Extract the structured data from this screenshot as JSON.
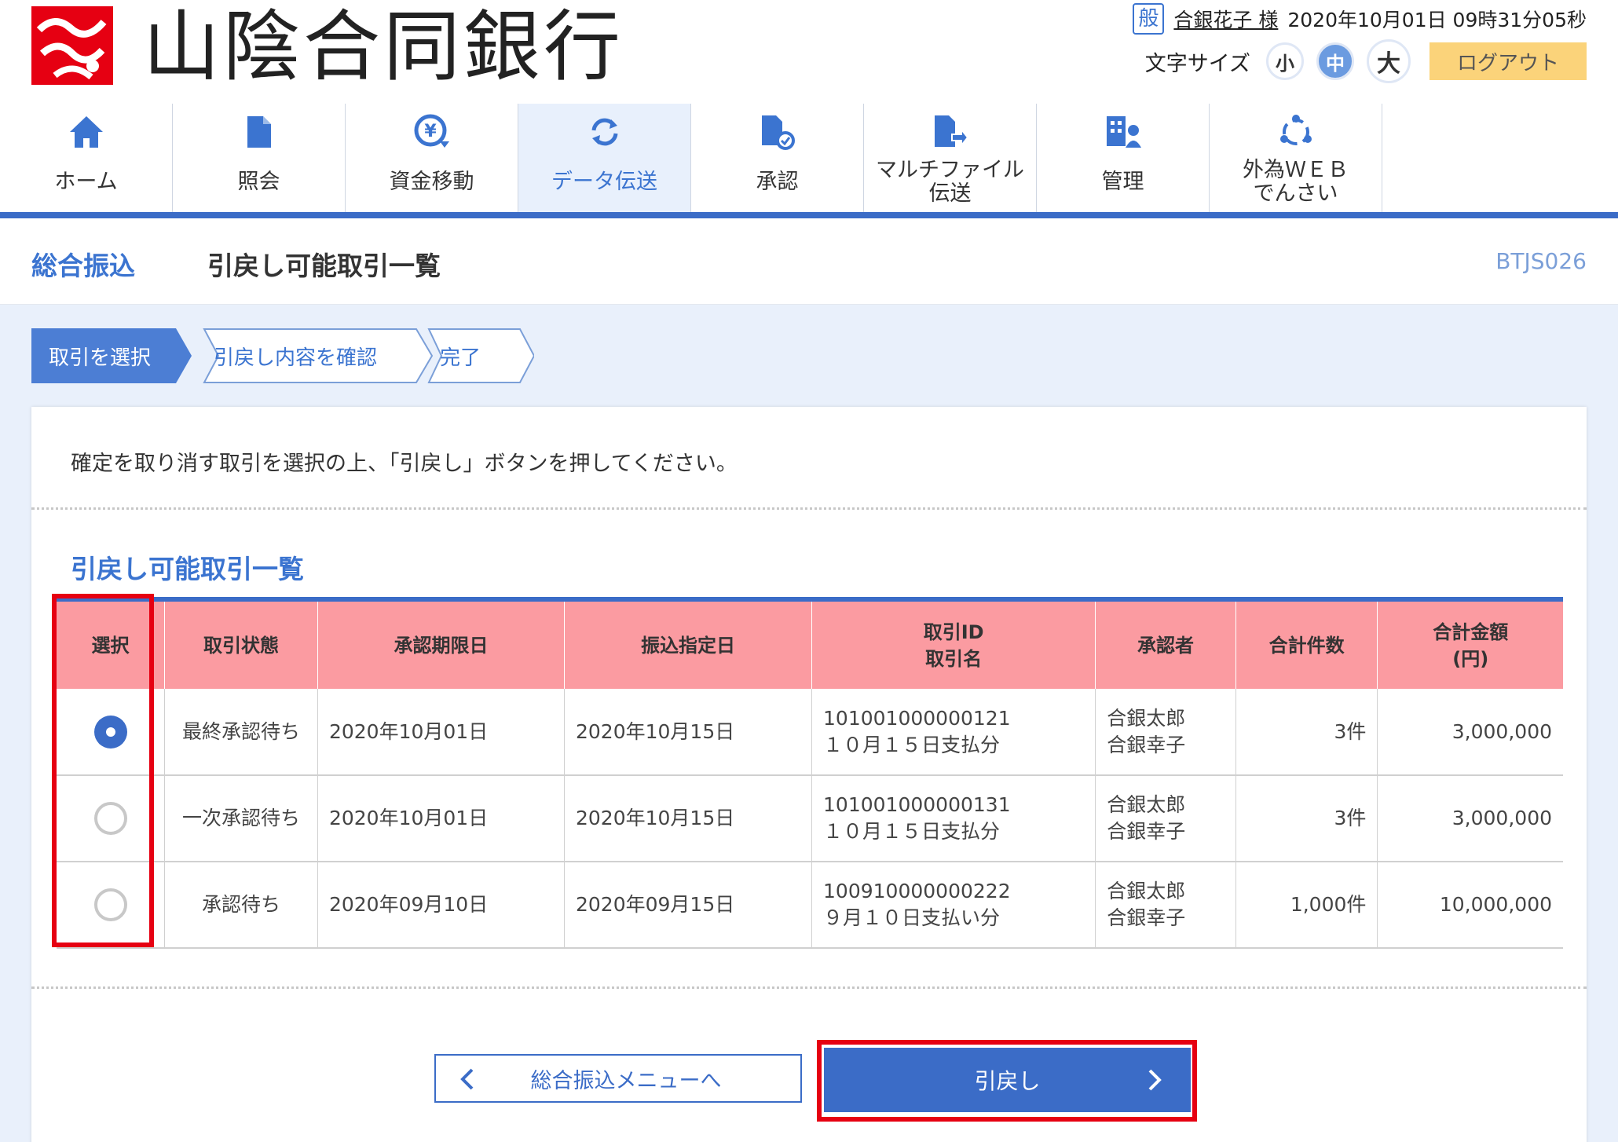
{
  "bank": {
    "name": "山陰合同銀行"
  },
  "user": {
    "badge": "般",
    "name": "合銀花子 様",
    "datetime": "2020年10月01日 09時31分05秒"
  },
  "font_size": {
    "label": "文字サイズ",
    "small": "小",
    "medium": "中",
    "large": "大",
    "selected": "中"
  },
  "logout_label": "ログアウト",
  "nav": {
    "items": [
      {
        "label": "ホーム",
        "icon": "home-icon"
      },
      {
        "label": "照会",
        "icon": "document-icon"
      },
      {
        "label": "資金移動",
        "icon": "yen-transfer-icon"
      },
      {
        "label": "データ伝送",
        "icon": "refresh-icon",
        "active": true
      },
      {
        "label": "承認",
        "icon": "approve-document-icon"
      },
      {
        "label": "マルチファイル\n伝送",
        "icon": "file-transfer-icon"
      },
      {
        "label": "管理",
        "icon": "management-icon"
      },
      {
        "label": "外為ＷＥＢ\nでんさい",
        "icon": "cycle-icon"
      }
    ]
  },
  "page": {
    "category": "総合振込",
    "title": "引戻し可能取引一覧",
    "screen_id": "BTJS026"
  },
  "steps": [
    "取引を選択",
    "引戻し内容を確認",
    "完了"
  ],
  "instruction": "確定を取り消す取引を選択の上、「引戻し」ボタンを押してください。",
  "section_title": "引戻し可能取引一覧",
  "table": {
    "headers": {
      "select": "選択",
      "status": "取引状態",
      "deadline": "承認期限日",
      "transfer_date": "振込指定日",
      "id_line1": "取引ID",
      "id_line2": "取引名",
      "approver": "承認者",
      "count": "合計件数",
      "amount_line1": "合計金額",
      "amount_line2": "(円)"
    },
    "rows": [
      {
        "selected": true,
        "status": "最終承認待ち",
        "deadline": "2020年10月01日",
        "transfer_date": "2020年10月15日",
        "id": "101001000000121",
        "name": "１０月１５日支払分",
        "approver1": "合銀太郎",
        "approver2": "合銀幸子",
        "count": "3件",
        "amount": "3,000,000"
      },
      {
        "selected": false,
        "status": "一次承認待ち",
        "deadline": "2020年10月01日",
        "transfer_date": "2020年10月15日",
        "id": "101001000000131",
        "name": "１０月１５日支払分",
        "approver1": "合銀太郎",
        "approver2": "合銀幸子",
        "count": "3件",
        "amount": "3,000,000"
      },
      {
        "selected": false,
        "status": "承認待ち",
        "deadline": "2020年09月10日",
        "transfer_date": "2020年09月15日",
        "id": "100910000000222",
        "name": "９月１０日支払い分",
        "approver1": "合銀太郎",
        "approver2": "合銀幸子",
        "count": "1,000件",
        "amount": "10,000,000"
      }
    ]
  },
  "buttons": {
    "back": "総合振込メニューへ",
    "submit": "引戻し"
  },
  "colors": {
    "brand_red": "#e60012",
    "accent_blue": "#3b6cc7",
    "header_pink": "#fb9ba1",
    "logout_yellow": "#fbd37a",
    "content_bg": "#e9f0fb"
  }
}
